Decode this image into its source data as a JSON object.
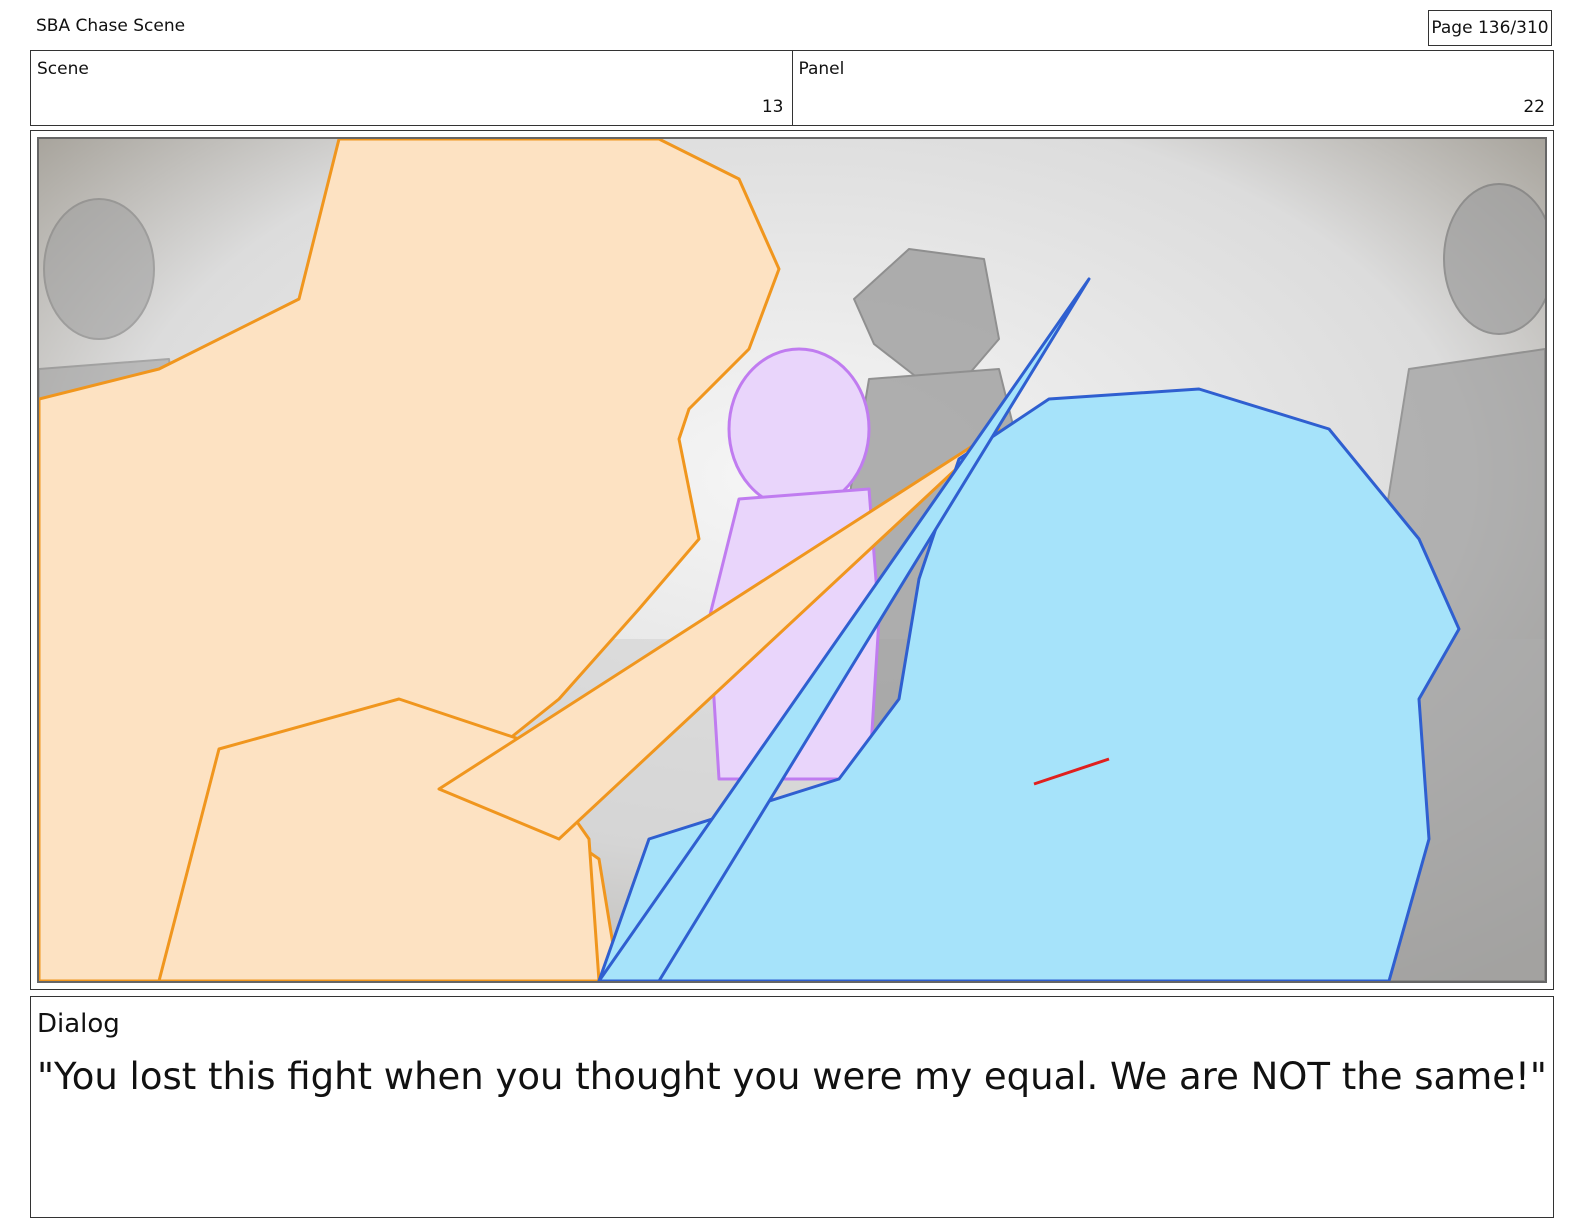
{
  "header": {
    "project_title": "SBA Chase Scene",
    "page_indicator": "Page 136/310"
  },
  "info": {
    "scene_label": "Scene",
    "scene_value": "13",
    "panel_label": "Panel",
    "panel_value": "22"
  },
  "panel": {
    "palette": {
      "orange_fill": "#FDE2C2",
      "orange_line": "#F0961E",
      "blue_fill": "#A6E3FA",
      "blue_line": "#2F5FD0",
      "purple_fill": "#E9D5FB",
      "purple_line": "#C07CF0",
      "gray_figure": "#9E9E9E",
      "blood_red": "#E0201E"
    }
  },
  "dialog": {
    "label": "Dialog",
    "text": "\"You lost this fight when you thought you were my equal. We are NOT the same!\""
  }
}
